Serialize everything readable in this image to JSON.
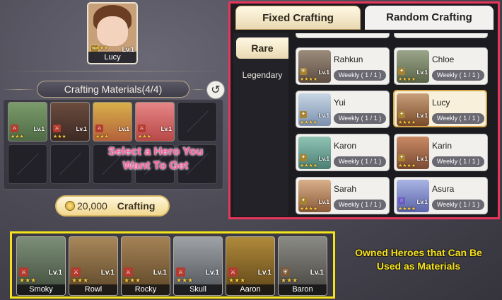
{
  "selected_hero": {
    "name": "Lucy",
    "level": "Lv.1",
    "stars": "★★★★"
  },
  "materials_header": {
    "label": "Crafting Materials(4/4)"
  },
  "materials": [
    {
      "level": "Lv.1",
      "stars": "★★★"
    },
    {
      "level": "Lv.1",
      "stars": "★★★"
    },
    {
      "level": "Lv.1",
      "stars": "★★★"
    },
    {
      "level": "Lv.1",
      "stars": "★★★"
    }
  ],
  "hint": {
    "line1": "Select a Hero You",
    "line2": "Want To Get"
  },
  "craft_button": {
    "cost": "20,000",
    "label": "Crafting"
  },
  "tabs": {
    "fixed": "Fixed Crafting",
    "random": "Random Crafting"
  },
  "categories": {
    "rare": "Rare",
    "legendary": "Legendary"
  },
  "craft_list": [
    {
      "name": "Rahkun",
      "weekly": "Weekly ( 1 / 1 )",
      "level": "Lv.1",
      "stars": "★★★★"
    },
    {
      "name": "Chloe",
      "weekly": "Weekly ( 1 / 1 )",
      "level": "Lv.1",
      "stars": "★★★★"
    },
    {
      "name": "Yui",
      "weekly": "Weekly ( 1 / 1 )",
      "level": "Lv.1",
      "stars": "★★★★"
    },
    {
      "name": "Lucy",
      "weekly": "Weekly ( 1 / 1 )",
      "level": "Lv.1",
      "stars": "★★★★"
    },
    {
      "name": "Karon",
      "weekly": "Weekly ( 1 / 1 )",
      "level": "Lv.1",
      "stars": "★★★★"
    },
    {
      "name": "Karin",
      "weekly": "Weekly ( 1 / 1 )",
      "level": "Lv.1",
      "stars": "★★★★"
    },
    {
      "name": "Sarah",
      "weekly": "Weekly ( 1 / 1 )",
      "level": "Lv.1",
      "stars": "★★★★"
    },
    {
      "name": "Asura",
      "weekly": "Weekly ( 1 / 1 )",
      "level": "Lv.1",
      "stars": "★★★★"
    }
  ],
  "owned_heroes": [
    {
      "name": "Smoky",
      "level": "Lv.1",
      "stars": "★★★"
    },
    {
      "name": "Rowl",
      "level": "Lv.1",
      "stars": "★★★"
    },
    {
      "name": "Rocky",
      "level": "Lv.1",
      "stars": "★★★"
    },
    {
      "name": "Skull",
      "level": "Lv.1",
      "stars": "★★★"
    },
    {
      "name": "Aaron",
      "level": "Lv.1",
      "stars": "★★★"
    },
    {
      "name": "Baron",
      "level": "Lv.1",
      "stars": "★★★"
    }
  ],
  "owned_caption": {
    "line1": "Owned Heroes that Can Be",
    "line2": "Used as Materials"
  },
  "colors": {
    "highlight_red": "#e8355a",
    "highlight_yellow": "#f4e21c",
    "hint_pink": "#ff5fa0"
  }
}
